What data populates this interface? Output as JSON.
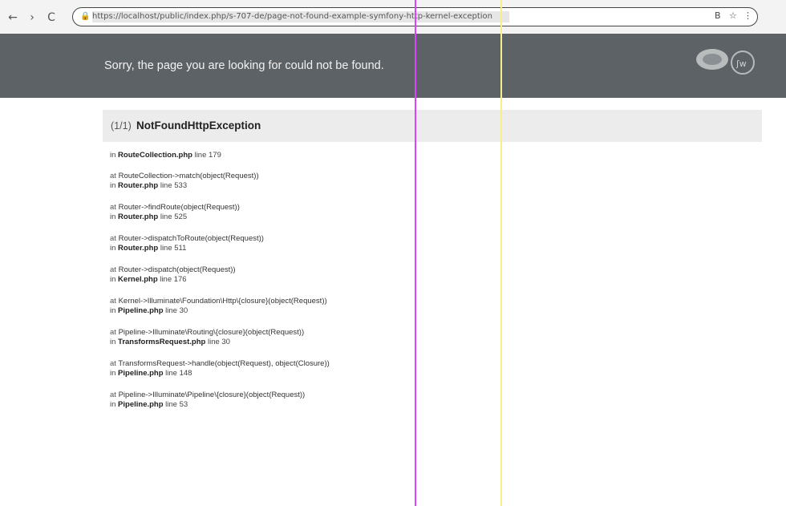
{
  "browser": {
    "back": "←",
    "forward": "›",
    "reload": "C",
    "url": "https://localhost/public/index.php/s-707-de/page-not-found-example-symfony-http-kernel-exception",
    "omnibox_icons": [
      "B",
      "☆",
      "⋮"
    ]
  },
  "error": {
    "title": "Sorry, the page you are looking for could not be found."
  },
  "exception": {
    "count": "1/1",
    "name": "NotFoundHttpException"
  },
  "trace": [
    {
      "at": "",
      "call": "",
      "location": "in RouteCollection.php line 179"
    },
    {
      "at": "at",
      "call": "RouteCollection->match(object(Request))",
      "location": "in Router.php line 533"
    },
    {
      "at": "at",
      "call": "Router->findRoute(object(Request))",
      "location": "in Router.php line 525"
    },
    {
      "at": "at",
      "call": "Router->dispatchToRoute(object(Request))",
      "location": "in Router.php line 511"
    },
    {
      "at": "at",
      "call": "Router->dispatch(object(Request))",
      "location": "in Kernel.php line 176"
    },
    {
      "at": "at",
      "call": "Kernel->Illuminate\\Foundation\\Http\\{closure}(object(Request))",
      "location": "in Pipeline.php line 30"
    },
    {
      "at": "at",
      "call": "Pipeline->Illuminate\\Routing\\{closure}(object(Request))",
      "location": "in TransformsRequest.php line 30"
    },
    {
      "at": "at",
      "call": "TransformsRequest->handle(object(Request), object(Closure))",
      "location": "in Pipeline.php line 148"
    },
    {
      "at": "at",
      "call": "Pipeline->Illuminate\\Pipeline\\{closure}(object(Request))",
      "location": "in Pipeline.php line 53"
    }
  ],
  "colors": {
    "header_bg": "#5d6266",
    "bar_bg": "#ececec",
    "artifact_magenta": "#e040ff",
    "artifact_yellow": "#f7f08a"
  }
}
